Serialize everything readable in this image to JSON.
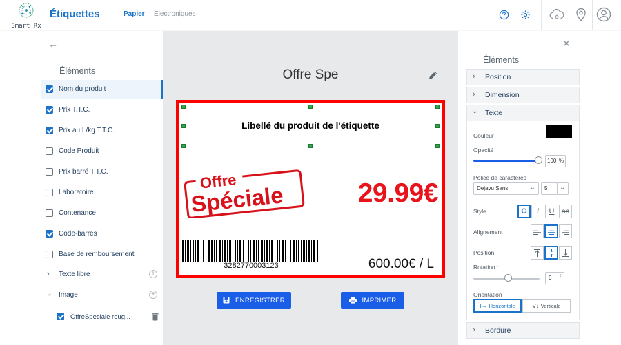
{
  "header": {
    "brand": "Smart Rx",
    "title": "Étiquettes",
    "tabs": [
      {
        "label": "Papier",
        "active": true
      },
      {
        "label": "Électroniques",
        "active": false
      }
    ],
    "icons": [
      "help-circle-icon",
      "settings-icon",
      "cloud-cog-icon",
      "location-pin-icon",
      "user-account-icon"
    ]
  },
  "left_panel": {
    "title": "Éléments",
    "elements": [
      {
        "label": "Nom du produit",
        "checked": true,
        "active": true
      },
      {
        "label": "Prix T.T.C.",
        "checked": true
      },
      {
        "label": "Prix au L/kg T.T.C.",
        "checked": true
      },
      {
        "label": "Code Produit",
        "checked": false
      },
      {
        "label": "Prix barré T.T.C.",
        "checked": false
      },
      {
        "label": "Laboratoire",
        "checked": false
      },
      {
        "label": "Contenance",
        "checked": false
      },
      {
        "label": "Code-barres",
        "checked": true
      },
      {
        "label": "Base de remboursement",
        "checked": false
      }
    ],
    "texte_libre": "Texte libre",
    "image": "Image",
    "image_item": "OffreSpeciale roug..."
  },
  "canvas": {
    "doc_title": "Offre Spe",
    "label": {
      "product_label": "Libellé du produit de l'étiquette",
      "stamp_line1": "Offre",
      "stamp_line2": "Spéciale",
      "price": "29.99€",
      "barcode_number": "3282770003123",
      "unit_price": "600.00€ / L"
    },
    "buttons": {
      "save": "ENREGISTRER",
      "print": "IMPRIMER"
    }
  },
  "right_panel": {
    "title": "Éléments",
    "sections": {
      "position": "Position",
      "dimension": "Dimension",
      "texte": "Texte",
      "bordure": "Bordure"
    },
    "couleur_label": "Couleur",
    "couleur_value": "#000000",
    "opacite_label": "Opacité",
    "opacite_value": "100",
    "opacite_unit": "%",
    "police_label": "Police de caractères",
    "police_value": "Dejavu Sans",
    "police_size": "5",
    "style_label": "Style",
    "style_buttons": [
      "G",
      "I",
      "U",
      "ab"
    ],
    "alignement_label": "Alignement",
    "position_label": "Position",
    "rotation_label": "Rotation :",
    "rotation_value": "0",
    "orientation_label": "Orientation",
    "orientation_h": "Horizontale",
    "orientation_v": "Verticale"
  }
}
